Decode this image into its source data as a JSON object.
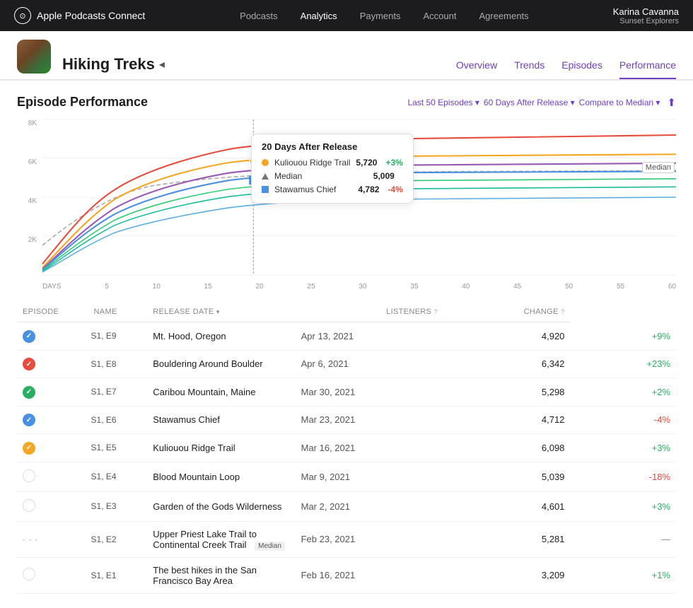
{
  "app": {
    "brand": "Apple Podcasts Connect",
    "nav_links": [
      {
        "label": "Podcasts",
        "active": false
      },
      {
        "label": "Analytics",
        "active": true
      },
      {
        "label": "Payments",
        "active": false
      },
      {
        "label": "Account",
        "active": false
      },
      {
        "label": "Agreements",
        "active": false
      }
    ],
    "user_name": "Karina Cavanna",
    "user_show": "Sunset Explorers",
    "user_chevron": "▾"
  },
  "podcast": {
    "title": "Hiking Treks",
    "chevron": "◂",
    "tabs": [
      "Overview",
      "Trends",
      "Episodes",
      "Performance"
    ]
  },
  "performance": {
    "section_title": "Episode Performance",
    "filters": {
      "episodes": "Last 50 Episodes ▾",
      "days": "60 Days After Release ▾",
      "compare": "Compare to Median ▾"
    },
    "chart": {
      "y_labels": [
        "8K",
        "6K",
        "4K",
        "2K",
        ""
      ],
      "x_labels": [
        "DAYS",
        "5",
        "10",
        "15",
        "20",
        "25",
        "30",
        "35",
        "40",
        "45",
        "50",
        "55",
        "60"
      ],
      "tooltip": {
        "title": "20 Days After Release",
        "rows": [
          {
            "type": "dot",
            "color": "#f5a623",
            "name": "Kuliouou Ridge Trail",
            "value": "5,720",
            "change": "+3%",
            "positive": true
          },
          {
            "type": "tri",
            "color": "#777",
            "name": "Median",
            "value": "5,009",
            "change": "",
            "positive": null
          },
          {
            "type": "sq",
            "color": "#4a90e2",
            "name": "Stawamus Chief",
            "value": "4,782",
            "change": "-4%",
            "positive": false
          }
        ]
      },
      "median_label": "Median"
    },
    "table": {
      "headers": [
        {
          "label": "EPISODE",
          "sortable": false
        },
        {
          "label": "NAME",
          "sortable": false
        },
        {
          "label": "RELEASE DATE",
          "sortable": true
        },
        {
          "label": "LISTENERS",
          "sortable": false,
          "info": true
        },
        {
          "label": "CHANGE",
          "sortable": false,
          "info": true
        }
      ],
      "rows": [
        {
          "icon_type": "blue",
          "episode": "S1, E9",
          "name": "Mt. Hood, Oregon",
          "date": "Apr 13, 2021",
          "listeners": "4,920",
          "change": "+9%",
          "change_type": "pos"
        },
        {
          "icon_type": "red",
          "episode": "S1, E8",
          "name": "Bouldering Around Boulder",
          "date": "Apr 6, 2021",
          "listeners": "6,342",
          "change": "+23%",
          "change_type": "pos"
        },
        {
          "icon_type": "green",
          "episode": "S1, E7",
          "name": "Caribou Mountain, Maine",
          "date": "Mar 30, 2021",
          "listeners": "5,298",
          "change": "+2%",
          "change_type": "pos"
        },
        {
          "icon_type": "blue",
          "episode": "S1, E6",
          "name": "Stawamus Chief",
          "date": "Mar 23, 2021",
          "listeners": "4,712",
          "change": "-4%",
          "change_type": "neg"
        },
        {
          "icon_type": "orange",
          "episode": "S1, E5",
          "name": "Kuliouou Ridge Trail",
          "date": "Mar 16, 2021",
          "listeners": "6,098",
          "change": "+3%",
          "change_type": "pos"
        },
        {
          "icon_type": "none",
          "episode": "S1, E4",
          "name": "Blood Mountain Loop",
          "date": "Mar 9, 2021",
          "listeners": "5,039",
          "change": "-18%",
          "change_type": "neg"
        },
        {
          "icon_type": "none",
          "episode": "S1, E3",
          "name": "Garden of the Gods Wilderness",
          "date": "Mar 2, 2021",
          "listeners": "4,601",
          "change": "+3%",
          "change_type": "pos"
        },
        {
          "icon_type": "dash",
          "episode": "S1, E2",
          "name": "Upper Priest Lake Trail to Continental Creek Trail",
          "median": true,
          "date": "Feb 23, 2021",
          "listeners": "5,281",
          "change": "—",
          "change_type": "neutral"
        },
        {
          "icon_type": "none",
          "episode": "S1, E1",
          "name": "The best hikes in the San Francisco Bay Area",
          "date": "Feb 16, 2021",
          "listeners": "3,209",
          "change": "+1%",
          "change_type": "pos"
        }
      ]
    }
  }
}
